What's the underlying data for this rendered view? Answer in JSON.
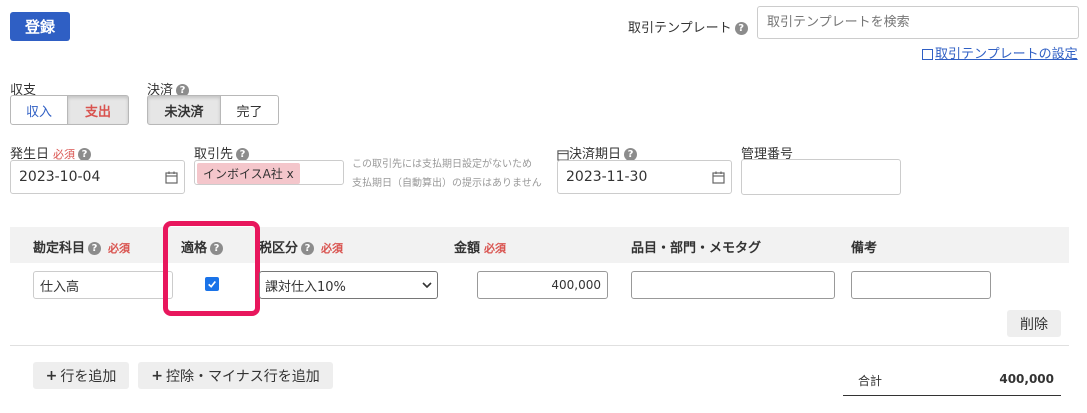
{
  "register_button": "登録",
  "template": {
    "label": "取引テンプレート",
    "search_placeholder": "取引テンプレートを検索",
    "settings_link": "取引テンプレートの設定"
  },
  "income_expense": {
    "label": "収支",
    "options": [
      "収入",
      "支出"
    ],
    "selected": "支出"
  },
  "settlement": {
    "label": "決済",
    "options": [
      "未決済",
      "完了"
    ],
    "selected": "未決済"
  },
  "required_mark": "必須",
  "issue_date": {
    "label": "発生日",
    "value": "2023-10-04"
  },
  "partner": {
    "label": "取引先",
    "tag": "インボイスA社 x",
    "note_line1": "この取引先には支払期日設定がないため",
    "note_line2": "支払期日（自動算出）の提示はありません"
  },
  "due_date": {
    "label": "決済期日",
    "value": "2023-11-30"
  },
  "management_number": {
    "label": "管理番号",
    "value": ""
  },
  "table": {
    "headers": {
      "account": "勘定科目",
      "qualified": "適格",
      "tax": "税区分",
      "amount": "金額",
      "items": "品目・部門・メモタグ",
      "remarks": "備考"
    },
    "row": {
      "account": "仕入高",
      "qualified_checked": true,
      "tax": "課対仕入10%",
      "amount": "400,000",
      "items": "",
      "remarks": ""
    },
    "delete_button": "削除"
  },
  "add_row_button": "行を追加",
  "add_deduction_button": "控除・マイナス行を追加",
  "total": {
    "label": "合計",
    "value": "400,000"
  },
  "colors": {
    "primary": "#2f5fc4",
    "required": "#d9534f",
    "highlight": "#e8175d",
    "partner_tag_bg": "#f4c6cb",
    "header_bg": "#f2f2f2"
  }
}
